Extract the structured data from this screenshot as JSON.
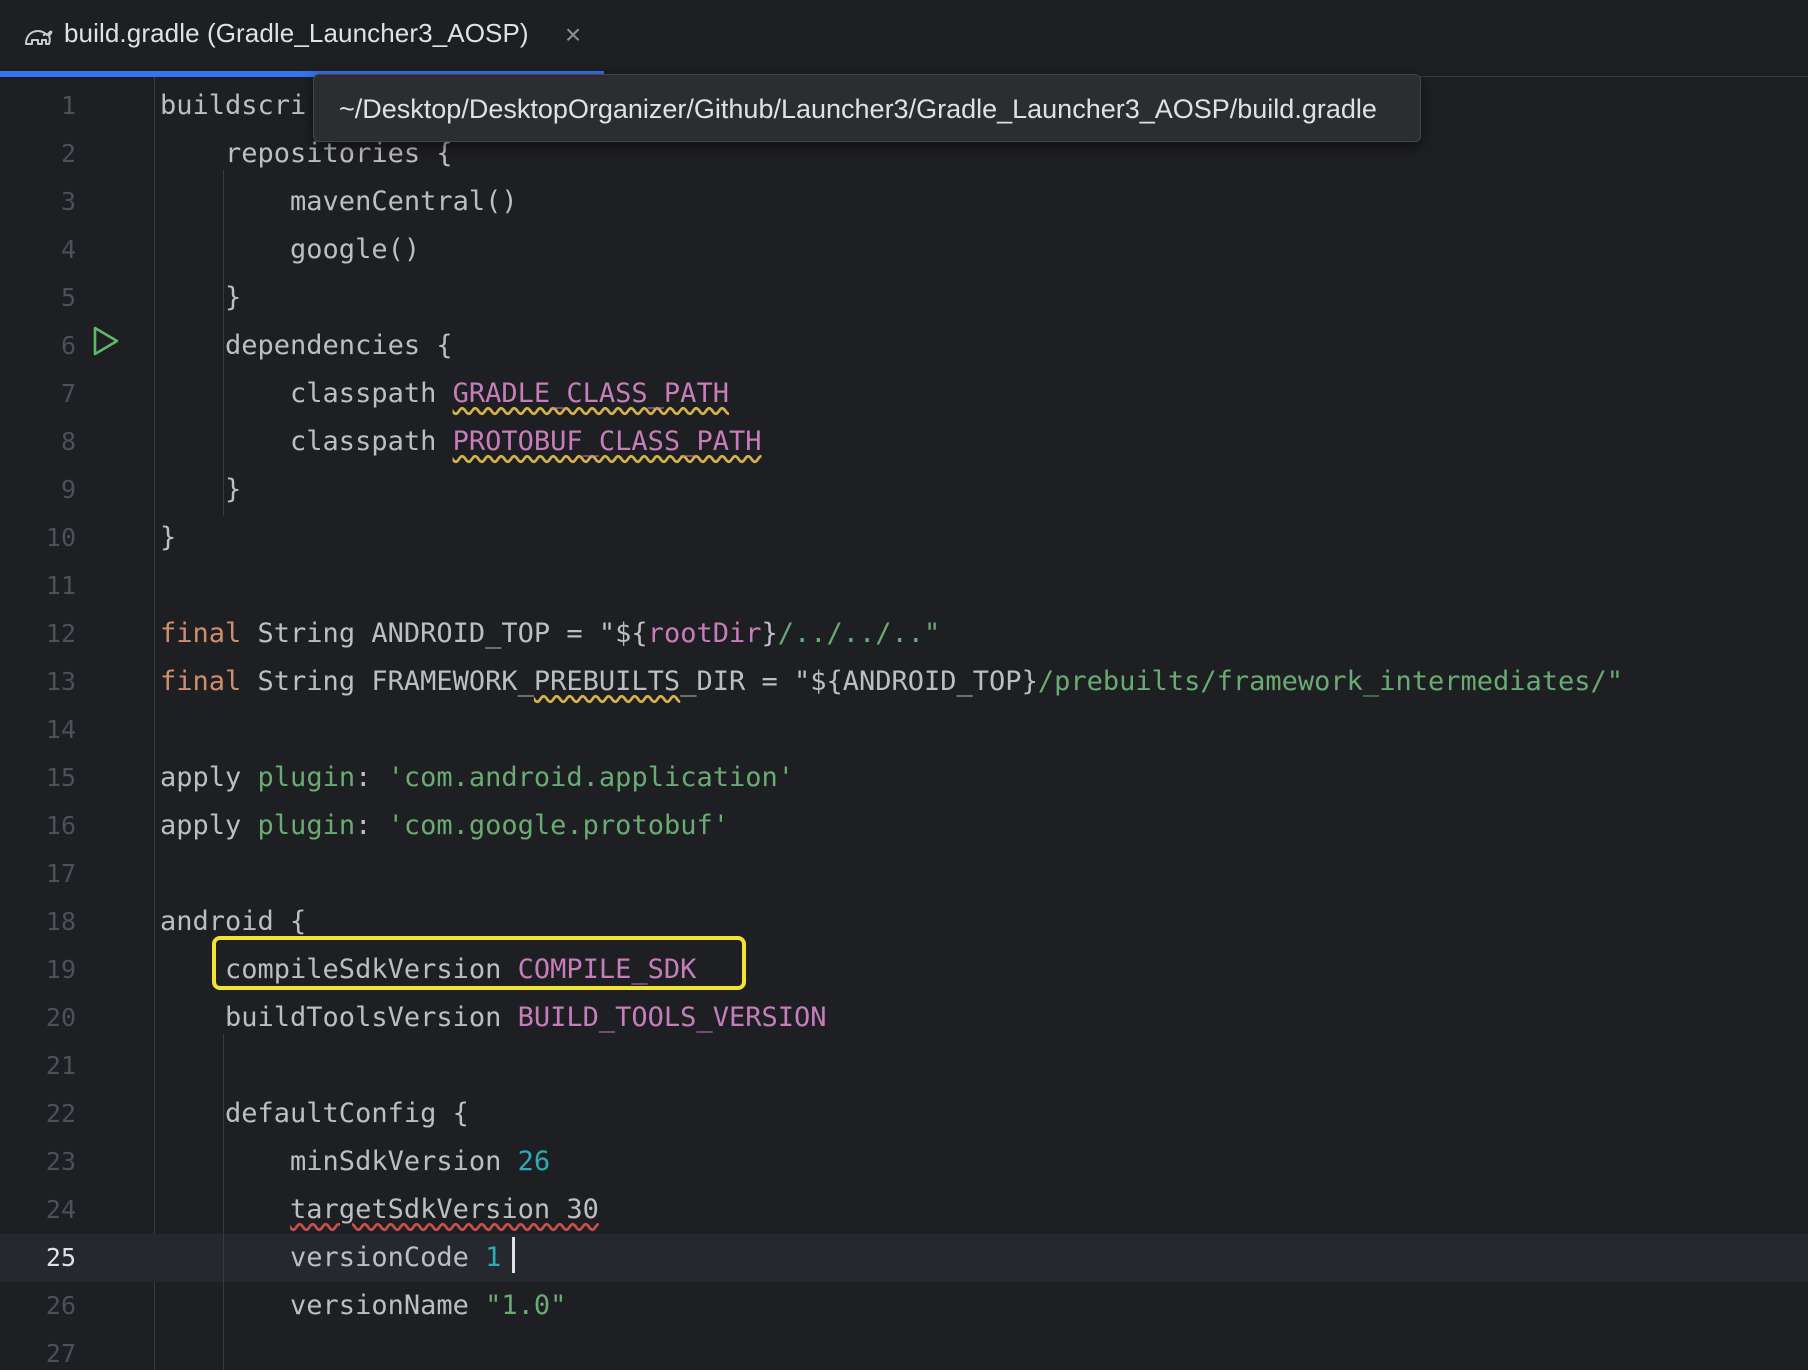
{
  "tab": {
    "icon": "gradle-elephant-icon",
    "title": "build.gradle (Gradle_Launcher3_AOSP)",
    "close": "×"
  },
  "tooltip": {
    "path": "~/Desktop/DesktopOrganizer/Github/Launcher3/Gradle_Launcher3_AOSP/build.gradle"
  },
  "editor": {
    "current_line": 25,
    "lines": [
      {
        "n": "1",
        "segs": [
          {
            "t": "buildscri",
            "c": ""
          }
        ]
      },
      {
        "n": "2",
        "segs": [
          {
            "t": "    repositories {",
            "c": ""
          }
        ]
      },
      {
        "n": "3",
        "segs": [
          {
            "t": "        mavenCentral()",
            "c": ""
          }
        ]
      },
      {
        "n": "4",
        "segs": [
          {
            "t": "        google()",
            "c": ""
          }
        ]
      },
      {
        "n": "5",
        "segs": [
          {
            "t": "    }",
            "c": ""
          }
        ]
      },
      {
        "n": "6",
        "segs": [
          {
            "t": "    dependencies {",
            "c": ""
          }
        ]
      },
      {
        "n": "7",
        "segs": [
          {
            "t": "        classpath ",
            "c": ""
          },
          {
            "t": "GRADLE_CLASS_PATH",
            "c": "const warn-y"
          }
        ]
      },
      {
        "n": "8",
        "segs": [
          {
            "t": "        classpath ",
            "c": ""
          },
          {
            "t": "PROTOBUF_CLASS_PATH",
            "c": "const warn-y"
          }
        ]
      },
      {
        "n": "9",
        "segs": [
          {
            "t": "    }",
            "c": ""
          }
        ]
      },
      {
        "n": "10",
        "segs": [
          {
            "t": "}",
            "c": ""
          }
        ]
      },
      {
        "n": "11",
        "segs": []
      },
      {
        "n": "12",
        "segs": [
          {
            "t": "final",
            "c": "kw"
          },
          {
            "t": " String ANDROID_TOP = ",
            "c": ""
          },
          {
            "t": "\"${",
            "c": "str-plain"
          },
          {
            "t": "rootDir",
            "c": "const"
          },
          {
            "t": "}",
            "c": ""
          },
          {
            "t": "/../../..\"",
            "c": "str"
          }
        ]
      },
      {
        "n": "13",
        "segs": [
          {
            "t": "final",
            "c": "kw"
          },
          {
            "t": " String FRAMEWORK_",
            "c": ""
          },
          {
            "t": "PREBUILTS",
            "c": "warn-y"
          },
          {
            "t": "_DIR = \"${ANDROID_TOP}",
            "c": ""
          },
          {
            "t": "/prebuilts/framework_intermediates/\"",
            "c": "str"
          }
        ]
      },
      {
        "n": "14",
        "segs": []
      },
      {
        "n": "15",
        "segs": [
          {
            "t": "apply ",
            "c": ""
          },
          {
            "t": "plugin",
            "c": "named"
          },
          {
            "t": ": ",
            "c": ""
          },
          {
            "t": "'com.android.application'",
            "c": "str"
          }
        ]
      },
      {
        "n": "16",
        "segs": [
          {
            "t": "apply ",
            "c": ""
          },
          {
            "t": "plugin",
            "c": "named"
          },
          {
            "t": ": ",
            "c": ""
          },
          {
            "t": "'com.google.protobuf'",
            "c": "str"
          }
        ]
      },
      {
        "n": "17",
        "segs": []
      },
      {
        "n": "18",
        "segs": [
          {
            "t": "android {",
            "c": ""
          }
        ]
      },
      {
        "n": "19",
        "segs": [
          {
            "t": "    compileSdkVersion ",
            "c": ""
          },
          {
            "t": "COMPILE_SDK",
            "c": "const"
          }
        ]
      },
      {
        "n": "20",
        "segs": [
          {
            "t": "    buildToolsVersion ",
            "c": ""
          },
          {
            "t": "BUILD_TOOLS_VERSION",
            "c": "const"
          }
        ]
      },
      {
        "n": "21",
        "segs": []
      },
      {
        "n": "22",
        "segs": [
          {
            "t": "    defaultConfig {",
            "c": ""
          }
        ]
      },
      {
        "n": "23",
        "segs": [
          {
            "t": "        minSdkVersion ",
            "c": ""
          },
          {
            "t": "26",
            "c": "num"
          }
        ]
      },
      {
        "n": "24",
        "segs": [
          {
            "t": "        ",
            "c": ""
          },
          {
            "t": "targetSdkVersion 30",
            "c": "warn-r"
          }
        ]
      },
      {
        "n": "25",
        "segs": [
          {
            "t": "        versionCode ",
            "c": ""
          },
          {
            "t": "1",
            "c": "num"
          }
        ]
      },
      {
        "n": "26",
        "segs": [
          {
            "t": "        versionName ",
            "c": ""
          },
          {
            "t": "\"1.0\"",
            "c": "str"
          }
        ]
      },
      {
        "n": "27",
        "segs": []
      }
    ]
  },
  "colors": {
    "background": "#1e1f22",
    "keyword": "#cf8e6d",
    "string": "#6aab73",
    "number": "#2aacb8",
    "constant": "#c77dbb",
    "highlight_box": "#f2e233",
    "tab_underline": "#3574f0"
  }
}
